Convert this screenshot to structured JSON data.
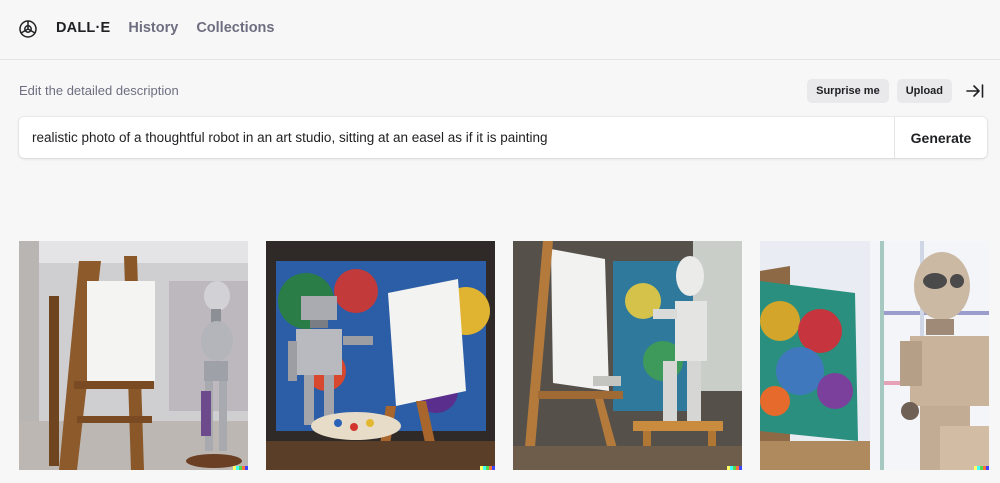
{
  "nav": {
    "logo_icon": "openai-logo-icon",
    "brand": "DALL·E",
    "history": "History",
    "collections": "Collections"
  },
  "editor": {
    "label": "Edit the detailed description",
    "surprise_label": "Surprise me",
    "upload_label": "Upload",
    "collapse_icon": "arrow-to-right-icon",
    "prompt": "realistic photo of a thoughtful robot in an art studio, sitting at an easel as if it is painting",
    "generate_label": "Generate"
  },
  "results": {
    "images": [
      {
        "subject": "chrome-robot-beside-wooden-easel"
      },
      {
        "subject": "silver-robot-painting-with-palette"
      },
      {
        "subject": "white-robot-seated-at-easel"
      },
      {
        "subject": "beige-robot-beside-colorful-canvas"
      }
    ],
    "signature_colors": [
      "#ffff66",
      "#42ffff",
      "#51da4c",
      "#ff6e3c",
      "#3c46ff"
    ]
  }
}
